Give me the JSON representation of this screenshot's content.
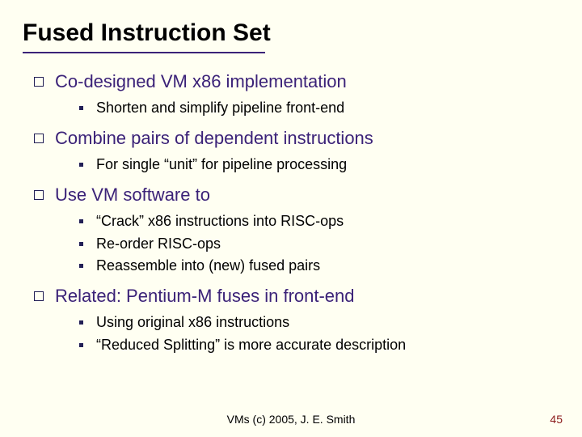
{
  "title": "Fused Instruction Set",
  "sections": [
    {
      "heading": "Co-designed VM  x86 implementation",
      "items": [
        "Shorten and simplify pipeline front-end"
      ]
    },
    {
      "heading": "Combine pairs of dependent instructions",
      "items": [
        "For single “unit” for pipeline processing"
      ]
    },
    {
      "heading": "Use VM software to",
      "items": [
        "“Crack” x86 instructions into RISC-ops",
        "Re-order RISC-ops",
        "Reassemble into (new) fused pairs"
      ]
    },
    {
      "heading": "Related: Pentium-M fuses in front-end",
      "items": [
        "Using original x86 instructions",
        "“Reduced Splitting” is more accurate description"
      ]
    }
  ],
  "footer": "VMs (c) 2005, J. E. Smith",
  "page_number": "45"
}
